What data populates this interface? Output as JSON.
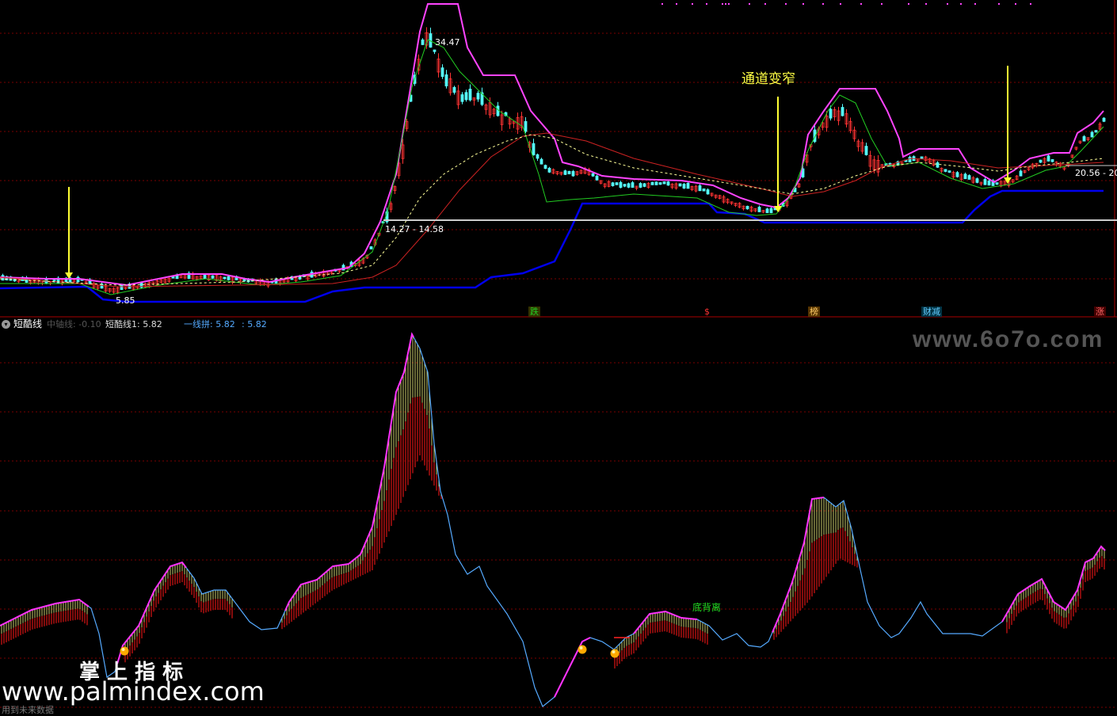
{
  "main_panel": {
    "annotations": {
      "channel_narrowing": "通道变窄",
      "high_price": "34.47",
      "range_left": "14.27 - 14.58",
      "range_right": "20.56 - 20",
      "low_price": "5.85"
    },
    "signal_badges": [
      {
        "text": "跌",
        "color": "#22cc22",
        "bg": "#333300"
      },
      {
        "text": "$",
        "color": "#ff3333",
        "bg": "#000000"
      },
      {
        "text": "榜",
        "color": "#ffcc66",
        "bg": "#553300"
      },
      {
        "text": "财减",
        "color": "#66ccff",
        "bg": "#003344"
      },
      {
        "text": "涨",
        "color": "#ff6666",
        "bg": "#440000"
      }
    ]
  },
  "indicator_panel": {
    "title": "短酷线",
    "legend": [
      {
        "text": "中轴线: -0.10",
        "color": "#555555"
      },
      {
        "text": "短酷线1: 5.82",
        "color": "#dddddd"
      },
      {
        "text": "一线拼: 5.82",
        "color": "#55aaff"
      },
      {
        "text": ": 5.82",
        "color": "#55aaff"
      }
    ],
    "divergence_label": "底背离"
  },
  "watermarks": {
    "top_right": "www.6o7o.com",
    "bottom_left_cn": "掌 上 指 标",
    "bottom_left_url": "www.palmindex.com",
    "bottom_left_small": "用到未来数据"
  },
  "colors": {
    "candle_up": "#ff3333",
    "candle_down": "#55ffff",
    "upper_band": "#ff44ff",
    "lower_band": "#0000ee",
    "ma_red": "#cc2222",
    "ma_white_dash": "#ffff99",
    "green_line": "#22cc22",
    "arrow": "#ffff33",
    "grid": "#7a0000",
    "indicator_cyan": "#55aaff",
    "indicator_magenta": "#ff33ff",
    "bar_red": "#bb1111",
    "bar_yellow": "#ffff88"
  }
}
